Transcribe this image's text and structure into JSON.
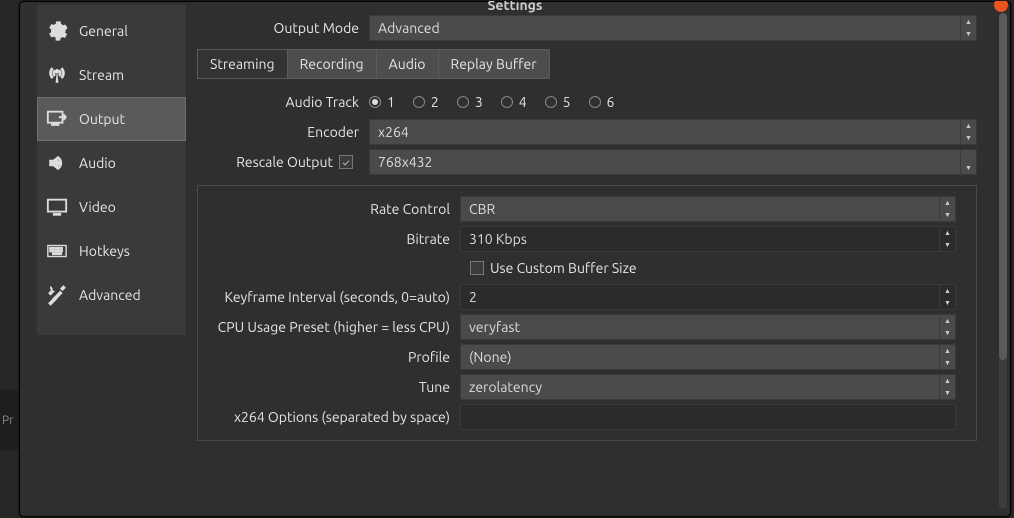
{
  "window": {
    "title": "Settings"
  },
  "sidebar": {
    "items": [
      {
        "label": "General"
      },
      {
        "label": "Stream"
      },
      {
        "label": "Output"
      },
      {
        "label": "Audio"
      },
      {
        "label": "Video"
      },
      {
        "label": "Hotkeys"
      },
      {
        "label": "Advanced"
      }
    ],
    "active_index": 2
  },
  "output_mode": {
    "label": "Output Mode",
    "value": "Advanced"
  },
  "tabs": {
    "items": [
      {
        "label": "Streaming"
      },
      {
        "label": "Recording"
      },
      {
        "label": "Audio"
      },
      {
        "label": "Replay Buffer"
      }
    ],
    "active_index": 0
  },
  "audio_track": {
    "label": "Audio Track",
    "options": [
      "1",
      "2",
      "3",
      "4",
      "5",
      "6"
    ],
    "selected_index": 0
  },
  "encoder": {
    "label": "Encoder",
    "value": "x264"
  },
  "rescale": {
    "label": "Rescale Output",
    "checked": true,
    "value": "768x432"
  },
  "encoder_settings": {
    "rate_control": {
      "label": "Rate Control",
      "value": "CBR"
    },
    "bitrate": {
      "label": "Bitrate",
      "value": "310 Kbps"
    },
    "custom_buffer": {
      "label": "Use Custom Buffer Size",
      "checked": false
    },
    "keyframe": {
      "label": "Keyframe Interval (seconds, 0=auto)",
      "value": "2"
    },
    "cpu_preset": {
      "label": "CPU Usage Preset (higher = less CPU)",
      "value": "veryfast"
    },
    "profile": {
      "label": "Profile",
      "value": "(None)"
    },
    "tune": {
      "label": "Tune",
      "value": "zerolatency"
    },
    "x264_opts": {
      "label": "x264 Options (separated by space)",
      "value": ""
    }
  },
  "behind": {
    "line1": "Pr",
    "line2": ""
  }
}
